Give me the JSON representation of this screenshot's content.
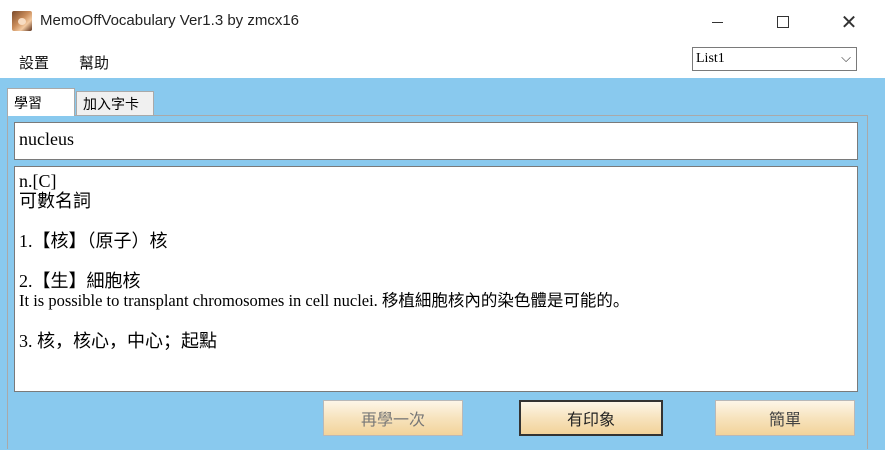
{
  "window": {
    "title": "MemoOffVocabulary Ver1.3 by zmcx16",
    "minimize_icon": "minimize-icon",
    "maximize_icon": "maximize-icon",
    "close_glyph": "✕"
  },
  "menu": {
    "settings": "設置",
    "help": "幫助"
  },
  "list_select": {
    "value": "List1",
    "chevron": "⌵"
  },
  "tabs": [
    {
      "label": "學習"
    },
    {
      "label": "加入字卡"
    }
  ],
  "word": "nucleus",
  "definition": {
    "lines": [
      "n.[C]",
      "可數名詞",
      "",
      "1.【核】（原子）核",
      "",
      "2.【生】細胞核",
      "It is possible to transplant chromosomes in cell nuclei. 移植細胞核內的染色體是可能的。",
      "",
      "3. 核，核心，中心；起點"
    ]
  },
  "buttons": {
    "again": "再學一次",
    "impression": "有印象",
    "easy": "簡單"
  }
}
